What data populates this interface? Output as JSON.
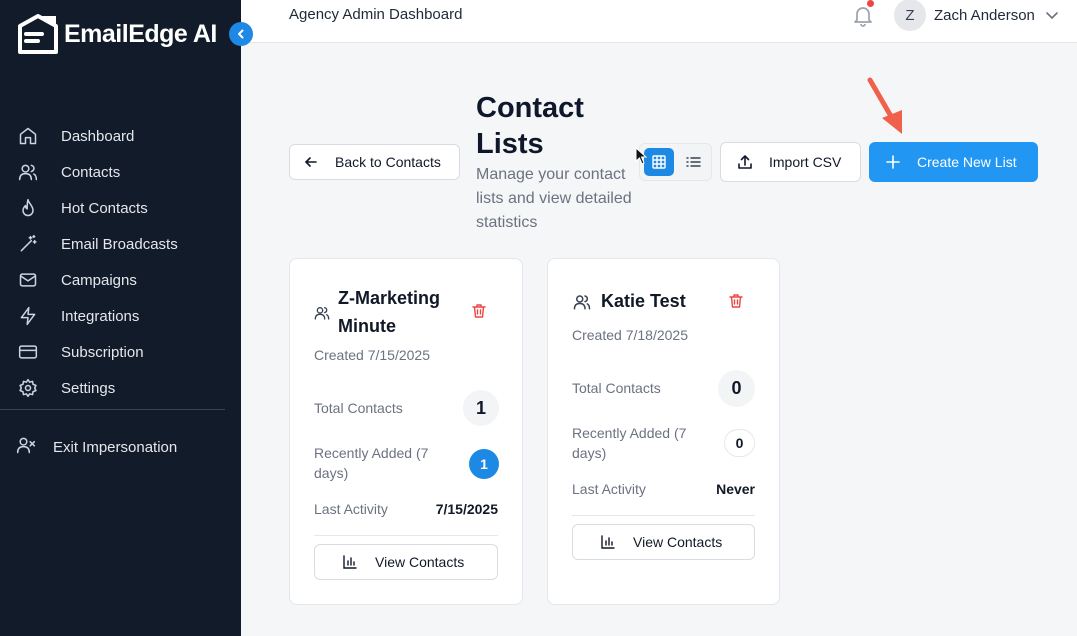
{
  "brand": {
    "name": "EmailEdge AI"
  },
  "sidebar": {
    "items": [
      {
        "label": "Dashboard",
        "icon": "home-icon"
      },
      {
        "label": "Contacts",
        "icon": "users-icon"
      },
      {
        "label": "Hot Contacts",
        "icon": "flame-icon"
      },
      {
        "label": "Email Broadcasts",
        "icon": "magic-wand-icon"
      },
      {
        "label": "Campaigns",
        "icon": "mail-icon"
      },
      {
        "label": "Integrations",
        "icon": "lightning-icon"
      },
      {
        "label": "Subscription",
        "icon": "credit-card-icon"
      },
      {
        "label": "Settings",
        "icon": "gear-icon"
      }
    ],
    "exit_label": "Exit Impersonation"
  },
  "header": {
    "title": "Agency Admin Dashboard",
    "user_initial": "Z",
    "user_name": "Zach Anderson"
  },
  "toolbar": {
    "back_label": "Back to Contacts",
    "title": "Contact Lists",
    "subtitle": "Manage your contact lists and view detailed statistics",
    "import_label": "Import CSV",
    "create_label": "Create New List",
    "active_view": "grid"
  },
  "cards": [
    {
      "name": "Z-Marketing Minute",
      "created": "Created 7/15/2025",
      "total_label": "Total Contacts",
      "total": "1",
      "recent_label": "Recently Added (7 days)",
      "recent": "1",
      "activity_label": "Last Activity",
      "activity": "7/15/2025",
      "button_label": "View Contacts"
    },
    {
      "name": "Katie Test",
      "created": "Created 7/18/2025",
      "total_label": "Total Contacts",
      "total": "0",
      "recent_label": "Recently Added (7 days)",
      "recent": "0",
      "activity_label": "Last Activity",
      "activity": "Never",
      "button_label": "View Contacts"
    }
  ],
  "colors": {
    "sidebar_bg": "#111b29",
    "primary": "#2196f3",
    "danger": "#ef4444",
    "annotation_arrow": "#f0604d"
  }
}
